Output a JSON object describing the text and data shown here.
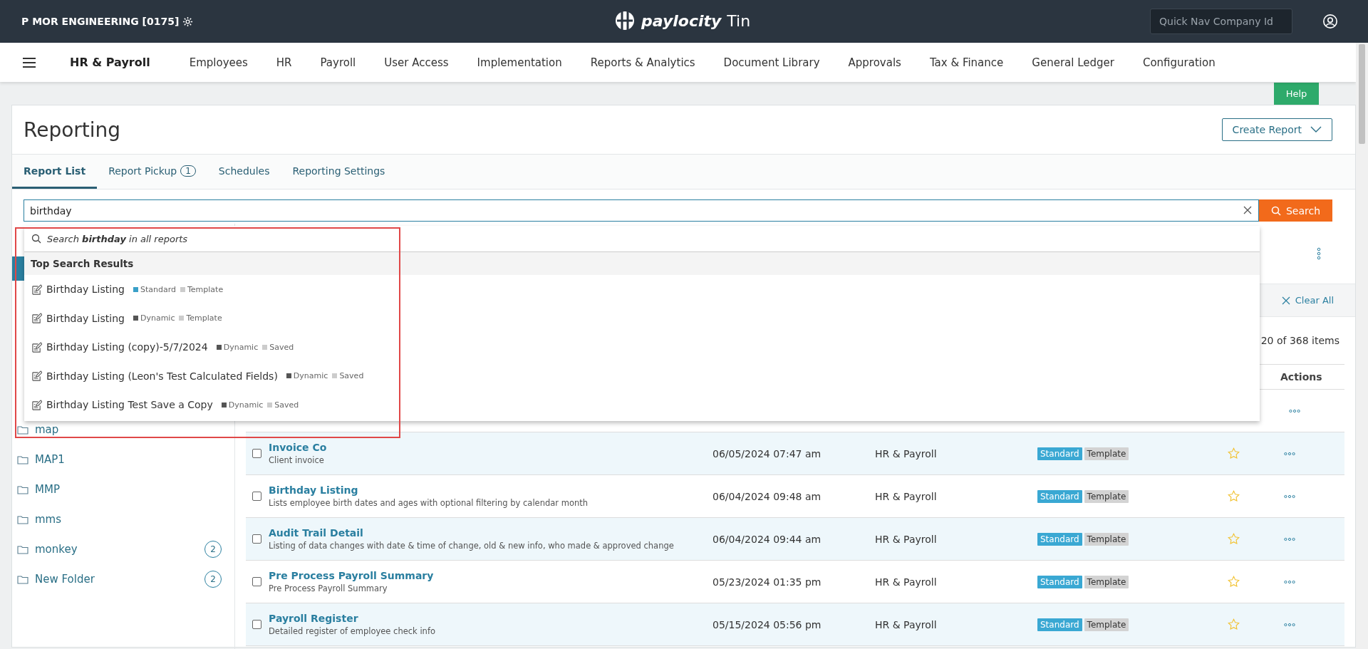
{
  "topbar": {
    "company": "P MOR ENGINEERING [0175]",
    "logo": "paylocity",
    "logo_suffix": "Tin",
    "quick_nav": {
      "placeholder": "Quick Nav Company Id"
    }
  },
  "navbar": {
    "product": "HR & Payroll",
    "items": [
      "Employees",
      "HR",
      "Payroll",
      "User Access",
      "Implementation",
      "Reports & Analytics",
      "Document Library",
      "Approvals",
      "Tax & Finance",
      "General Ledger",
      "Configuration"
    ]
  },
  "help_button": "Help",
  "page": {
    "title": "Reporting",
    "create_button": "Create Report"
  },
  "tabs": [
    {
      "label": "Report List",
      "selected": true
    },
    {
      "label": "Report Pickup",
      "badge": "1",
      "selected": false
    },
    {
      "label": "Schedules",
      "selected": false
    },
    {
      "label": "Reporting Settings",
      "selected": false
    }
  ],
  "search": {
    "value": "birthday",
    "button": "Search"
  },
  "dropdown": {
    "search_all": "Search **birthday** in all reports",
    "section": "Top Search Results",
    "results": [
      {
        "name": "Birthday Listing",
        "tags": [
          {
            "label": "Standard",
            "color": "#3aa0c8"
          },
          {
            "label": "Template",
            "color": "#cccccc"
          }
        ]
      },
      {
        "name": "Birthday Listing",
        "tags": [
          {
            "label": "Dynamic",
            "color": "#555555"
          },
          {
            "label": "Template",
            "color": "#cccccc"
          }
        ]
      },
      {
        "name": "Birthday Listing (copy)-5/7/2024",
        "tags": [
          {
            "label": "Dynamic",
            "color": "#555555"
          },
          {
            "label": "Saved",
            "color": "#cccccc"
          }
        ]
      },
      {
        "name": "Birthday Listing (Leon's Test Calculated Fields)",
        "tags": [
          {
            "label": "Dynamic",
            "color": "#555555"
          },
          {
            "label": "Saved",
            "color": "#cccccc"
          }
        ]
      },
      {
        "name": "Birthday Listing Test Save a Copy",
        "tags": [
          {
            "label": "Dynamic",
            "color": "#555555"
          },
          {
            "label": "Saved",
            "color": "#cccccc"
          }
        ]
      }
    ]
  },
  "folders": [
    {
      "name": "map"
    },
    {
      "name": "MAP1"
    },
    {
      "name": "MMP"
    },
    {
      "name": "mms"
    },
    {
      "name": "monkey",
      "count": "2"
    },
    {
      "name": "New Folder",
      "count": "2"
    }
  ],
  "filters": {
    "clear_all": "Clear All"
  },
  "item_count": "20 of 368 items",
  "table": {
    "columns": {
      "actions": "Actions"
    },
    "rows": [
      {
        "name": "Invoice Co",
        "description": "Client invoice",
        "date": "06/05/2024 07:47 am",
        "module": "HR & Payroll",
        "tags": [
          {
            "label": "Standard",
            "kind": "standard"
          },
          {
            "label": "Template",
            "kind": "template"
          }
        ],
        "favorite": false,
        "checked": false
      },
      {
        "name": "Birthday Listing",
        "description": "Lists employee birth dates and ages with optional filtering by calendar month",
        "date": "06/04/2024 09:48 am",
        "module": "HR & Payroll",
        "tags": [
          {
            "label": "Standard",
            "kind": "standard"
          },
          {
            "label": "Template",
            "kind": "template"
          }
        ],
        "favorite": false,
        "checked": false
      },
      {
        "name": "Audit Trail Detail",
        "description": "Listing of data changes with date & time of change, old & new info, who made & approved change",
        "date": "06/04/2024 09:44 am",
        "module": "HR & Payroll",
        "tags": [
          {
            "label": "Standard",
            "kind": "standard"
          },
          {
            "label": "Template",
            "kind": "template"
          }
        ],
        "favorite": false,
        "checked": false
      },
      {
        "name": "Pre Process Payroll Summary",
        "description": "Pre Process Payroll Summary",
        "date": "05/23/2024 01:35 pm",
        "module": "HR & Payroll",
        "tags": [
          {
            "label": "Standard",
            "kind": "standard"
          },
          {
            "label": "Template",
            "kind": "template"
          }
        ],
        "favorite": false,
        "checked": false
      },
      {
        "name": "Payroll Register",
        "description": "Detailed register of employee check info",
        "date": "05/15/2024 05:56 pm",
        "module": "HR & Payroll",
        "tags": [
          {
            "label": "Standard",
            "kind": "standard"
          },
          {
            "label": "Template",
            "kind": "template"
          }
        ],
        "favorite": false,
        "checked": false
      }
    ]
  }
}
